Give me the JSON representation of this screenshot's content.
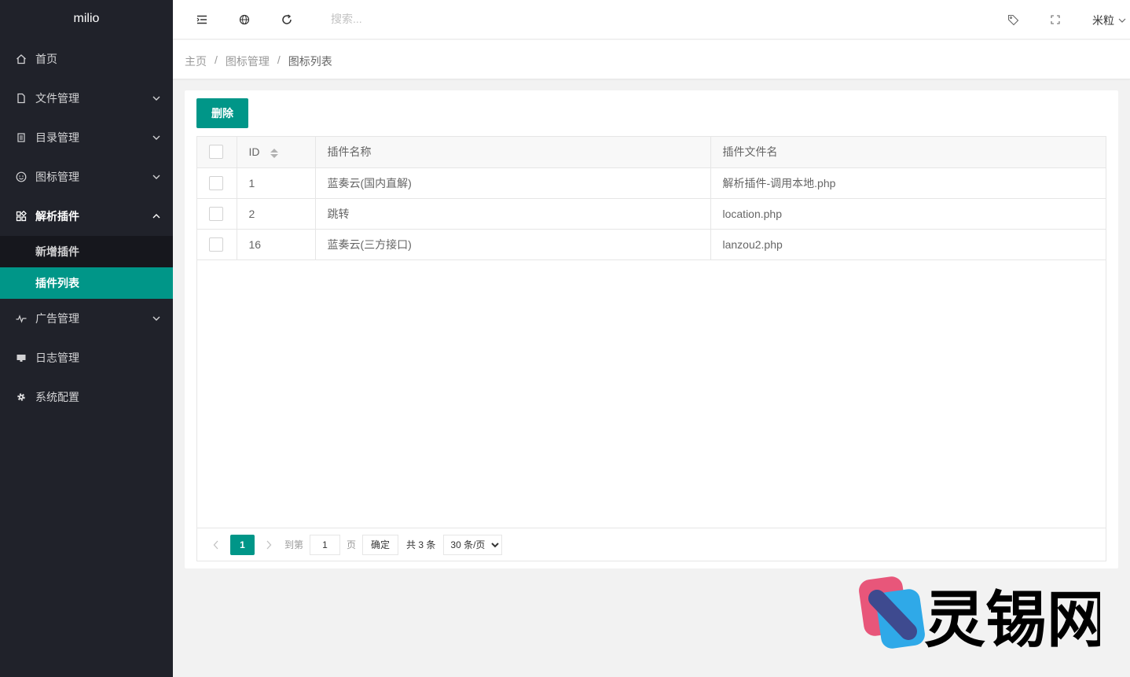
{
  "app": {
    "logo": "milio"
  },
  "sidebar": {
    "items": [
      {
        "label": "首页",
        "icon": "home-icon"
      },
      {
        "label": "文件管理",
        "icon": "file-icon"
      },
      {
        "label": "目录管理",
        "icon": "document-icon"
      },
      {
        "label": "图标管理",
        "icon": "smile-icon"
      },
      {
        "label": "解析插件",
        "icon": "apps-icon",
        "open": true,
        "children": [
          {
            "label": "新增插件"
          },
          {
            "label": "插件列表",
            "active": true
          }
        ]
      },
      {
        "label": "广告管理",
        "icon": "pulse-icon"
      },
      {
        "label": "日志管理",
        "icon": "monitor-icon"
      },
      {
        "label": "系统配置",
        "icon": "gear-icon"
      }
    ]
  },
  "header": {
    "search_placeholder": "搜索...",
    "user": "米粒"
  },
  "breadcrumb": {
    "home": "主页",
    "section": "图标管理",
    "current": "图标列表"
  },
  "toolbar": {
    "delete_label": "删除"
  },
  "table": {
    "columns": [
      "ID",
      "插件名称",
      "插件文件名"
    ],
    "rows": [
      {
        "id": "1",
        "name": "蓝奏云(国内直解)",
        "file": "解析插件-调用本地.php"
      },
      {
        "id": "2",
        "name": "跳转",
        "file": "location.php"
      },
      {
        "id": "16",
        "name": "蓝奏云(三方接口)",
        "file": "lanzou2.php"
      }
    ]
  },
  "pager": {
    "current_page": "1",
    "goto_label": "到第",
    "goto_value": "1",
    "page_label": "页",
    "confirm_label": "确定",
    "total_text": "共 3 条",
    "page_size": "30 条/页"
  },
  "watermark": {
    "text": "灵锡网"
  },
  "colors": {
    "accent": "#009688",
    "sidebar_bg": "#20222a"
  }
}
